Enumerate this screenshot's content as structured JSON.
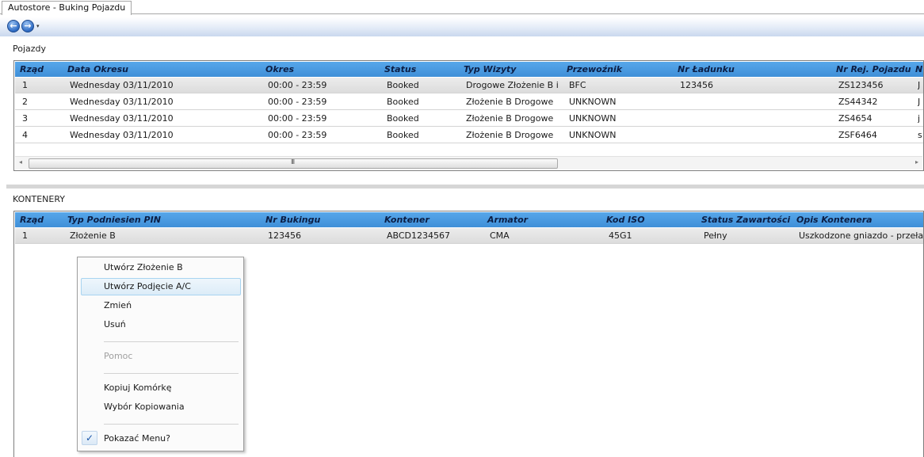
{
  "window": {
    "tab_title": "Autostore - Buking Pojazdu"
  },
  "toolbar": {
    "back_glyph": "←",
    "forward_glyph": "→",
    "dropdown_glyph": "▾"
  },
  "vehicles": {
    "section_label": "Pojazdy",
    "columns": [
      "Rząd",
      "Data Okresu",
      "Okres",
      "Status",
      "Typ Wizyty",
      "Przewoźnik",
      "Nr Ładunku",
      "Nr Rej. Pojazdu",
      "N"
    ],
    "rows": [
      [
        "1",
        "Wednesday 03/11/2010",
        "00:00 - 23:59",
        "Booked",
        "Drogowe Złożenie B i",
        "BFC",
        "123456",
        "ZS123456",
        "J"
      ],
      [
        "2",
        "Wednesday 03/11/2010",
        "00:00 - 23:59",
        "Booked",
        "Złożenie B Drogowe",
        "UNKNOWN",
        "",
        "ZS44342",
        "J"
      ],
      [
        "3",
        "Wednesday 03/11/2010",
        "00:00 - 23:59",
        "Booked",
        "Złożenie B Drogowe",
        "UNKNOWN",
        "",
        "ZS4654",
        "j"
      ],
      [
        "4",
        "Wednesday 03/11/2010",
        "00:00 - 23:59",
        "Booked",
        "Złożenie B Drogowe",
        "UNKNOWN",
        "",
        "ZSF6464",
        "s"
      ]
    ],
    "scroll_left": "◂",
    "scroll_right": "▸",
    "scroll_grip": "III"
  },
  "containers": {
    "section_label": "KONTENERY",
    "columns": [
      "Rząd",
      "Typ Podniesien PIN",
      "Nr Bukingu",
      "Kontener",
      "Armator",
      "Kod ISO",
      "Status Zawartości",
      "Opis Kontenera"
    ],
    "rows": [
      [
        "1",
        "Złożenie B",
        "123456",
        "ABCD1234567",
        "CMA",
        "45G1",
        "Pełny",
        "Uszkodzone gniazdo - przeła"
      ]
    ]
  },
  "context_menu": {
    "items": [
      {
        "label": "Utwórz Złożenie B"
      },
      {
        "label": "Utwórz Podjęcie A/C"
      },
      {
        "label": "Zmień"
      },
      {
        "label": "Usuń"
      },
      {
        "label": "Pomoc"
      },
      {
        "label": "Kopiuj Komórkę"
      },
      {
        "label": "Wybór Kopiowania"
      },
      {
        "label": "Pokazać Menu?"
      }
    ],
    "check_glyph": "✓"
  }
}
